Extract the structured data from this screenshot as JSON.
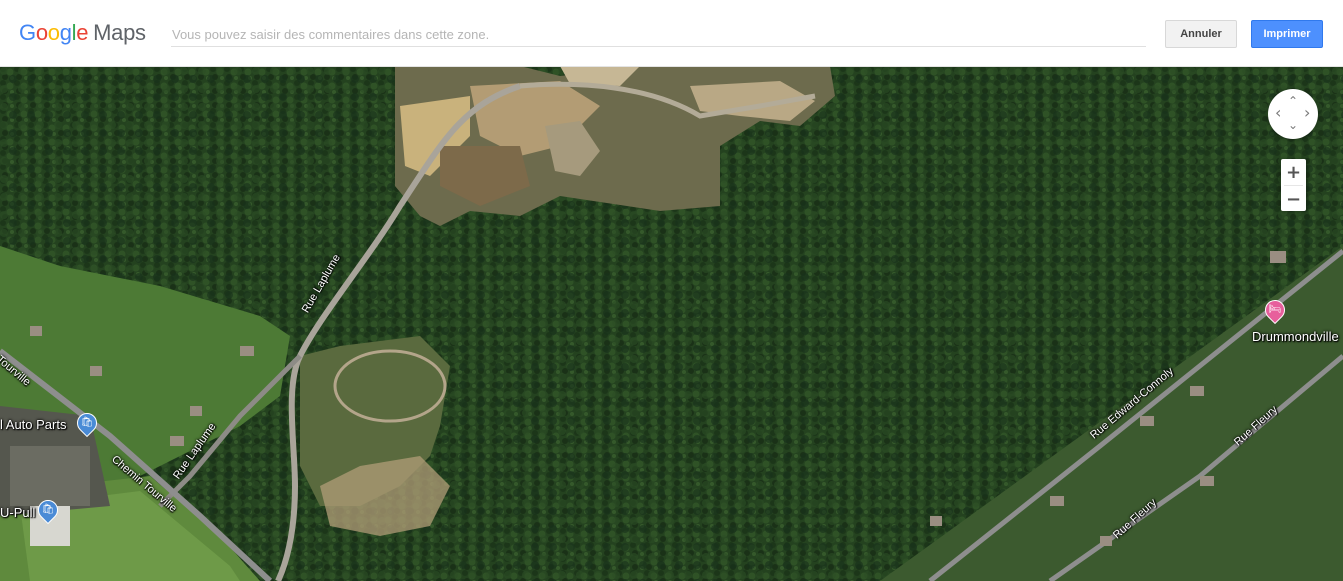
{
  "header": {
    "logo_letters": [
      "G",
      "o",
      "o",
      "g",
      "l",
      "e"
    ],
    "logo_colors": [
      "#4285f4",
      "#ea4335",
      "#fbbc05",
      "#4285f4",
      "#34a853",
      "#ea4335"
    ],
    "logo_product": "Maps",
    "comment_placeholder": "Vous pouvez saisir des commentaires dans cette zone.",
    "comment_value": "",
    "cancel_label": "Annuler",
    "print_label": "Imprimer"
  },
  "map": {
    "view": "satellite",
    "road_labels": {
      "rue_laplume_north": "Rue Laplume",
      "rue_laplume_south": "Rue Laplume",
      "chemin_tourville": "Chemin Tourville",
      "tourville_edge": "Tourville",
      "rue_edward_connoly": "Rue Edward-Connoly",
      "rue_fleury_east": "Rue Fleury",
      "rue_fleury_south": "Rue Fleury"
    },
    "places": {
      "auto_parts": "l Auto Parts",
      "u_pull": "U-Pull",
      "city": "Drummondville"
    },
    "pins": {
      "shopping_color": "#4a8bd6",
      "hotel_color": "#e75f9c"
    },
    "colors": {
      "forest": "#24421f",
      "dirt": "#bda67e",
      "field": "#4d7a35",
      "road": "#a9a49a"
    }
  },
  "controls": {
    "zoom_in": "+",
    "zoom_out": "−",
    "pan_up": "⌃",
    "pan_down": "⌄",
    "pan_left": "‹",
    "pan_right": "›"
  }
}
